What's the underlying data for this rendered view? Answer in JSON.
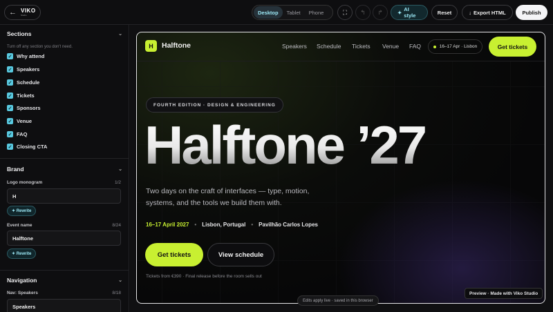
{
  "topbar": {
    "logo_text": "VIKO",
    "logo_sub": "Studio",
    "back_icon": "arrow-left-icon",
    "devices": [
      "Desktop",
      "Tablet",
      "Phone"
    ],
    "active_device": "Desktop",
    "fullscreen_icon": "expand-icon",
    "undo_icon": "undo-icon",
    "redo_icon": "redo-icon",
    "ai_label": "AI style",
    "reset_label": "Reset",
    "export_label": "Export HTML",
    "publish_label": "Publish",
    "accent": "#9be7f4"
  },
  "sidebar": {
    "sections": {
      "title": "Sections",
      "hint": "Turn off any section you don't need.",
      "items": [
        "Why attend",
        "Speakers",
        "Schedule",
        "Tickets",
        "Sponsors",
        "Venue",
        "FAQ",
        "Closing CTA"
      ]
    },
    "brand": {
      "title": "Brand",
      "monogram_label": "Logo monogram",
      "monogram_count": "1/2",
      "monogram_value": "H",
      "event_label": "Event name",
      "event_count": "8/24",
      "event_value": "Halftone",
      "rewrite_label": "Rewrite"
    },
    "navigation": {
      "title": "Navigation",
      "nav_speakers_label": "Nav: Speakers",
      "nav_speakers_count": "8/18",
      "nav_speakers_value": "Speakers"
    }
  },
  "preview": {
    "brand_mark": "H",
    "brand_name": "Halftone",
    "nav": [
      "Speakers",
      "Schedule",
      "Tickets",
      "Venue",
      "FAQ"
    ],
    "date_chip": "16–17 Apr · Lisbon",
    "nav_cta": "Get tickets",
    "eyebrow": "FOURTH EDITION · DESIGN & ENGINEERING",
    "headline": "Halftone ’27",
    "lede": "Two days on the craft of interfaces — type, motion, systems, and the tools we build them with.",
    "meta_date": "16–17 April 2027",
    "meta_city": "Lisbon, Portugal",
    "meta_venue": "Pavilhão Carlos Lopes",
    "meta_sep": "•",
    "cta_primary": "Get tickets",
    "cta_secondary": "View schedule",
    "fineprint": "Tickets from €390 · Final release before the room sells out",
    "badge": "Preview · Made with Viko Studio",
    "accent": "#c8f031"
  },
  "status": {
    "live_note": "Edits apply live · saved in this browser"
  }
}
